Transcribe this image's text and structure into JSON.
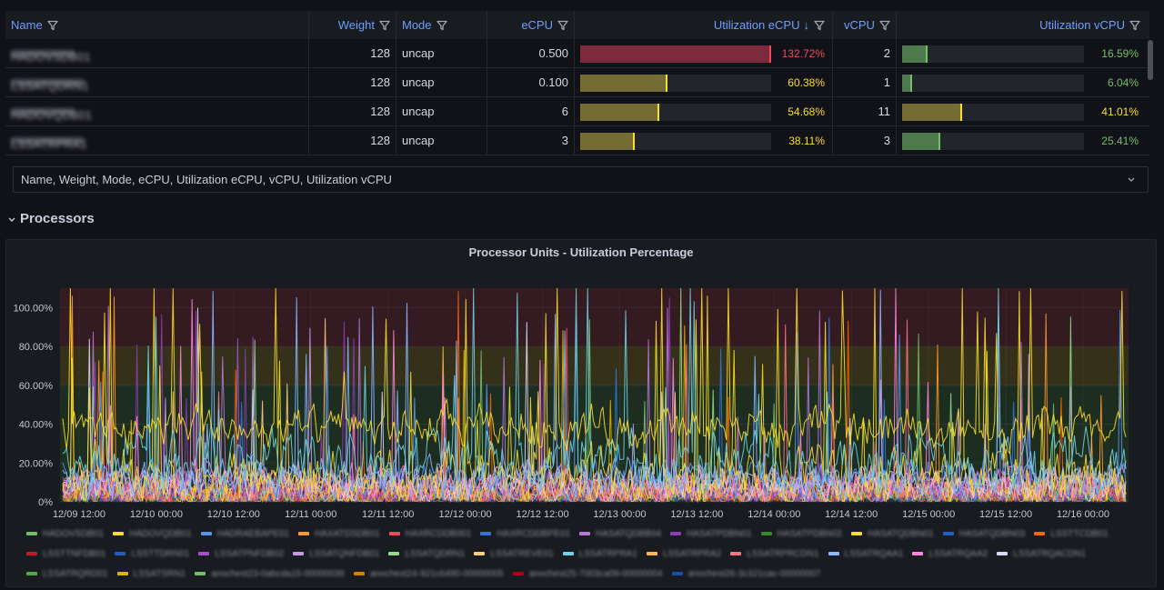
{
  "table": {
    "columns": [
      "Name",
      "Weight",
      "Mode",
      "eCPU",
      "Utilization eCPU",
      "vCPU",
      "Utilization vCPU"
    ],
    "sort_indicator": "↓",
    "rows": [
      {
        "name": "HADOVSDB01",
        "weight": "128",
        "mode": "uncap",
        "ecpu": "0.500",
        "util_ecpu": "132.72%",
        "util_ecpu_pct": 132.72,
        "vcpu": "2",
        "util_vcpu": "16.59%",
        "util_vcpu_pct": 16.59
      },
      {
        "name": "LSSATQDRN1",
        "weight": "128",
        "mode": "uncap",
        "ecpu": "0.100",
        "util_ecpu": "60.38%",
        "util_ecpu_pct": 60.38,
        "vcpu": "1",
        "util_vcpu": "6.04%",
        "util_vcpu_pct": 6.04
      },
      {
        "name": "HADOVQDB01",
        "weight": "128",
        "mode": "uncap",
        "ecpu": "6",
        "util_ecpu": "54.68%",
        "util_ecpu_pct": 54.68,
        "vcpu": "11",
        "util_vcpu": "41.01%",
        "util_vcpu_pct": 41.01
      },
      {
        "name": "LSSATRPRA1",
        "weight": "128",
        "mode": "uncap",
        "ecpu": "3",
        "util_ecpu": "38.11%",
        "util_ecpu_pct": 38.11,
        "vcpu": "3",
        "util_vcpu": "25.41%",
        "util_vcpu_pct": 25.41
      }
    ]
  },
  "column_select": {
    "value": "Name, Weight, Mode, eCPU, Utilization eCPU, vCPU, Utilization vCPU"
  },
  "section": {
    "title": "Processors"
  },
  "panel": {
    "title": "Processor Units - Utilization Percentage"
  },
  "colors": {
    "gauge_red": "#c4314b",
    "gauge_yellow": "#b8a93a",
    "gauge_green": "#73bf69",
    "text_red": "#f2495c",
    "text_yellow": "#fade2a",
    "text_green": "#73bf69",
    "header_blue": "#6e9fff"
  },
  "chart_data": {
    "type": "line",
    "title": "Processor Units - Utilization Percentage",
    "x_ticks": [
      "12/09 12:00",
      "12/10 00:00",
      "12/10 12:00",
      "12/11 00:00",
      "12/11 12:00",
      "12/12 00:00",
      "12/12 12:00",
      "12/13 00:00",
      "12/13 12:00",
      "12/14 00:00",
      "12/14 12:00",
      "12/15 00:00",
      "12/15 12:00",
      "12/16 00:00"
    ],
    "y_ticks": [
      "0%",
      "20.00%",
      "40.00%",
      "60.00%",
      "80.00%",
      "100.00%"
    ],
    "ylim": [
      0,
      110
    ],
    "thresholds": [
      {
        "from": 0,
        "to": 60,
        "color": "green"
      },
      {
        "from": 60,
        "to": 80,
        "color": "yellow"
      },
      {
        "from": 80,
        "to": 110,
        "color": "red"
      }
    ],
    "series": [
      {
        "name": "HADOVSDB01",
        "color": "#73bf69",
        "base": 3,
        "noise": 2,
        "spike": 0.01
      },
      {
        "name": "HADOVQDB01",
        "color": "#fade2a",
        "base": 38,
        "noise": 6,
        "spike": 0.03
      },
      {
        "name": "HADRAEBAPE01",
        "color": "#5794f2",
        "base": 12,
        "noise": 6,
        "spike": 0.02
      },
      {
        "name": "HAXATDSDB01",
        "color": "#ff9830",
        "base": 6,
        "noise": 4,
        "spike": 0.01
      },
      {
        "name": "HAXRCDDB001",
        "color": "#f2495c",
        "base": 5,
        "noise": 3,
        "spike": 0.01
      },
      {
        "name": "HAXRCDDBPE01",
        "color": "#3274d9",
        "base": 4,
        "noise": 3,
        "spike": 0.01
      },
      {
        "name": "HASATQDBB04",
        "color": "#b877d9",
        "base": 4,
        "noise": 4,
        "spike": 0.02
      },
      {
        "name": "HASATPDBN01",
        "color": "#8f3bb8",
        "base": 8,
        "noise": 5,
        "spike": 0.02
      },
      {
        "name": "HASATPDBN02",
        "color": "#37872d",
        "base": 3,
        "noise": 2,
        "spike": 0.0
      },
      {
        "name": "HASATQDBN01",
        "color": "#fade2a",
        "base": 14,
        "noise": 9,
        "spike": 0.05
      },
      {
        "name": "HASATQDBN03",
        "color": "#1f60c4",
        "base": 3,
        "noise": 2,
        "spike": 0.0
      },
      {
        "name": "LSSTTCDB01",
        "color": "#fa6400",
        "base": 4,
        "noise": 3,
        "spike": 0.01
      },
      {
        "name": "LSSTTNFDB01",
        "color": "#c4162a",
        "base": 3,
        "noise": 2,
        "spike": 0.0
      },
      {
        "name": "LSSTTDRN01",
        "color": "#1f60c4",
        "base": 3,
        "noise": 2,
        "spike": 0.0
      },
      {
        "name": "LSSATPNFDB02",
        "color": "#a352cc",
        "base": 5,
        "noise": 4,
        "spike": 0.01
      },
      {
        "name": "LSSATQNFDB01",
        "color": "#ca95e5",
        "base": 6,
        "noise": 4,
        "spike": 0.01
      },
      {
        "name": "LSSATQDRN1",
        "color": "#96d98d",
        "base": 6,
        "noise": 4,
        "spike": 0.01
      },
      {
        "name": "LSSATREVE01",
        "color": "#ffcb7d",
        "base": 9,
        "noise": 6,
        "spike": 0.02
      },
      {
        "name": "LSSATRPRA1",
        "color": "#6ed0e0",
        "base": 22,
        "noise": 9,
        "spike": 0.03
      },
      {
        "name": "LSSATRPRA2",
        "color": "#ffb357",
        "base": 8,
        "noise": 5,
        "spike": 0.01
      },
      {
        "name": "LSSATRPRCDN1",
        "color": "#ff7383",
        "base": 7,
        "noise": 5,
        "spike": 0.01
      },
      {
        "name": "LSSATRQAA1",
        "color": "#8ab8ff",
        "base": 12,
        "noise": 6,
        "spike": 0.02
      },
      {
        "name": "LSSATRQAA2",
        "color": "#fe85da",
        "base": 10,
        "noise": 6,
        "spike": 0.02
      },
      {
        "name": "LSSATRQACDN1",
        "color": "#dcd7f9",
        "base": 9,
        "noise": 5,
        "spike": 0.01
      },
      {
        "name": "LSSATRQRD01",
        "color": "#56a64b",
        "base": 3,
        "noise": 2,
        "spike": 0.0
      },
      {
        "name": "LSSATSRN1",
        "color": "#e0b400",
        "base": 4,
        "noise": 3,
        "spike": 0.01
      },
      {
        "name": "anochest23-0abcda15-00000036",
        "color": "#73bf69",
        "base": 2,
        "noise": 1,
        "spike": 0.0
      },
      {
        "name": "anochest24-921c6490-00000005",
        "color": "#d97d0a",
        "base": 2,
        "noise": 1,
        "spike": 0.0
      },
      {
        "name": "anochest25-7003ca09-00000004",
        "color": "#ad0317",
        "base": 2,
        "noise": 1,
        "spike": 0.0
      },
      {
        "name": "anochest26-3c321cac-00000007",
        "color": "#1250b0",
        "base": 2,
        "noise": 1,
        "spike": 0.0
      }
    ]
  }
}
